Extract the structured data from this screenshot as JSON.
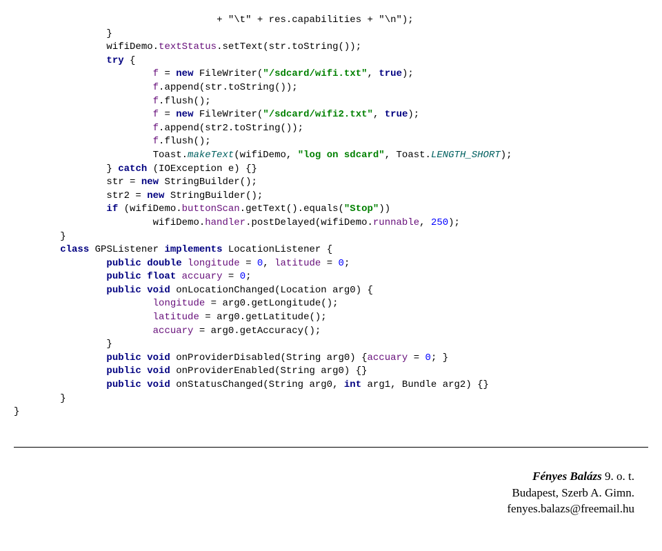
{
  "code": {
    "l1": "+ \"\\t\" + res.capabilities + \"\\n\");",
    "l2": "                }",
    "l3a": "                wifiDemo.",
    "l3b": "textStatus",
    "l3c": ".setText(str.toString());",
    "l4a": "                ",
    "l4b": "try",
    "l4c": " {",
    "l5a": "                        ",
    "l5b": "f",
    "l5c": " = ",
    "l5d": "new",
    "l5e": " FileWriter(",
    "l5f": "\"/sdcard/wifi.txt\"",
    "l5g": ", ",
    "l5h": "true",
    "l5i": ");",
    "l6a": "                        ",
    "l6b": "f",
    "l6c": ".append(str.toString());",
    "l7a": "                        ",
    "l7b": "f",
    "l7c": ".flush();",
    "l8a": "                        ",
    "l8b": "f",
    "l8c": " = ",
    "l8d": "new",
    "l8e": " FileWriter(",
    "l8f": "\"/sdcard/wifi2.txt\"",
    "l8g": ", ",
    "l8h": "true",
    "l8i": ");",
    "l9a": "                        ",
    "l9b": "f",
    "l9c": ".append(str2.toString());",
    "l10a": "                        ",
    "l10b": "f",
    "l10c": ".flush();",
    "l11a": "                        Toast.",
    "l11b": "makeText",
    "l11c": "(wifiDemo, ",
    "l11d": "\"log on sdcard\"",
    "l11e": ", Toast.",
    "l11f": "LENGTH_SHORT",
    "l11g": ");",
    "l12a": "                } ",
    "l12b": "catch",
    "l12c": " (IOException e) {}",
    "l13a": "                str = ",
    "l13b": "new",
    "l13c": " StringBuilder();",
    "l14a": "                str2 = ",
    "l14b": "new",
    "l14c": " StringBuilder();",
    "l15a": "                ",
    "l15b": "if",
    "l15c": " (wifiDemo.",
    "l15d": "buttonScan",
    "l15e": ".getText().equals(",
    "l15f": "\"Stop\"",
    "l15g": "))",
    "l16a": "                        wifiDemo.",
    "l16b": "handler",
    "l16c": ".postDelayed(wifiDemo.",
    "l16d": "runnable",
    "l16e": ", ",
    "l16f": "250",
    "l16g": ");",
    "l17": "        }",
    "l18a": "        ",
    "l18b": "class",
    "l18c": " GPSListener ",
    "l18d": "implements",
    "l18e": " LocationListener {",
    "l19a": "                ",
    "l19b": "public double",
    "l19c": " ",
    "l19d": "longitude",
    "l19e": " = ",
    "l19f": "0",
    "l19g": ", ",
    "l19h": "latitude",
    "l19i": " = ",
    "l19j": "0",
    "l19k": ";",
    "l20a": "                ",
    "l20b": "public float",
    "l20c": " ",
    "l20d": "accuary",
    "l20e": " = ",
    "l20f": "0",
    "l20g": ";",
    "l21a": "                ",
    "l21b": "public void",
    "l21c": " onLocationChanged(Location arg0) {",
    "l22a": "                        ",
    "l22b": "longitude",
    "l22c": " = arg0.getLongitude();",
    "l23a": "                        ",
    "l23b": "latitude",
    "l23c": " = arg0.getLatitude();",
    "l24a": "                        ",
    "l24b": "accuary",
    "l24c": " = arg0.getAccuracy();",
    "l25": "                }",
    "l26a": "                ",
    "l26b": "public void",
    "l26c": " onProviderDisabled(String arg0) {",
    "l26d": "accuary",
    "l26e": " = ",
    "l26f": "0",
    "l26g": "; }",
    "l27a": "                ",
    "l27b": "public void",
    "l27c": " onProviderEnabled(String arg0) {}",
    "l28a": "                ",
    "l28b": "public void",
    "l28c": " onStatusChanged(String arg0, ",
    "l28d": "int",
    "l28e": " arg1, Bundle arg2) {}",
    "l29": "        }",
    "l30": "}",
    "pad1": "                                   "
  },
  "footer": {
    "author": "Fényes Balázs",
    "class": " 9. o. t.",
    "school": "Budapest, Szerb A. Gimn.",
    "email": "fenyes.balazs@freemail.hu"
  }
}
